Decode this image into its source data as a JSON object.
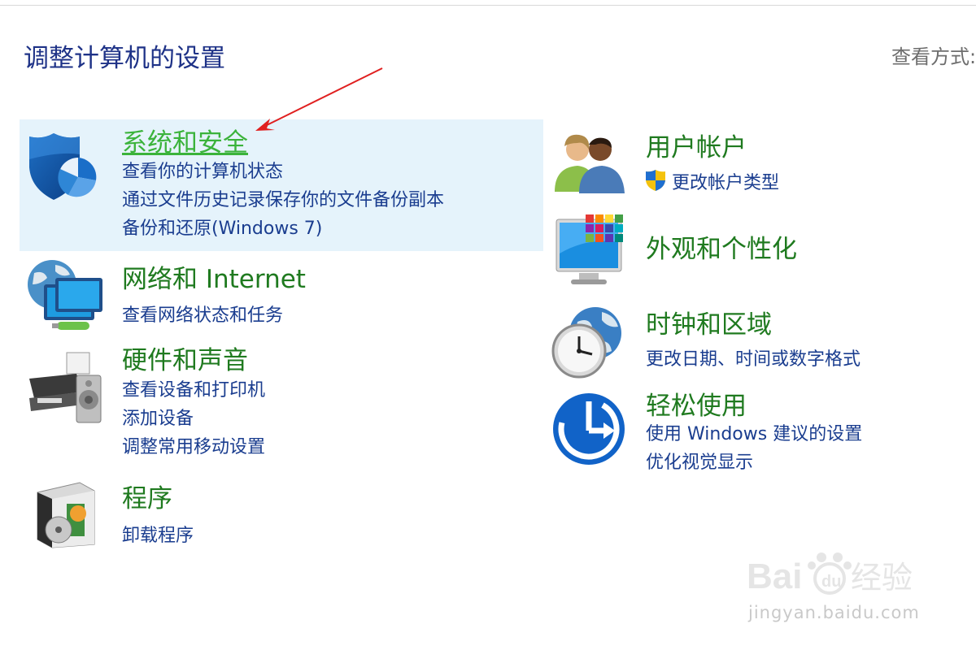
{
  "page_title": "调整计算机的设置",
  "view_by_label": "查看方式:",
  "left_categories": [
    {
      "title": "系统和安全",
      "links": [
        "查看你的计算机状态",
        "通过文件历史记录保存你的文件备份副本",
        "备份和还原(Windows 7)"
      ]
    },
    {
      "title": "网络和 Internet",
      "links": [
        "查看网络状态和任务"
      ]
    },
    {
      "title": "硬件和声音",
      "links": [
        "查看设备和打印机",
        "添加设备",
        "调整常用移动设置"
      ]
    },
    {
      "title": "程序",
      "links": [
        "卸载程序"
      ]
    }
  ],
  "right_categories": [
    {
      "title": "用户帐户",
      "links": [
        "更改帐户类型"
      ]
    },
    {
      "title": "外观和个性化",
      "links": []
    },
    {
      "title": "时钟和区域",
      "links": [
        "更改日期、时间或数字格式"
      ]
    },
    {
      "title": "轻松使用",
      "links": [
        "使用 Windows 建议的设置",
        "优化视觉显示"
      ]
    }
  ],
  "icons": {
    "system_security": "shield-icon",
    "network": "network-globe-icon",
    "hardware": "printer-speaker-icon",
    "programs": "program-box-icon",
    "user_accounts": "users-icon",
    "appearance": "monitor-color-icon",
    "clock_region": "clock-globe-icon",
    "ease_of_access": "ease-of-access-icon",
    "uac": "uac-shield-icon"
  },
  "watermark": {
    "brand": "Baidu",
    "cn": "经验",
    "url": "jingyan.baidu.com"
  },
  "colors": {
    "title_blue": "#1e3287",
    "category_green": "#1f7a1f",
    "active_green": "#3bb33b",
    "link_blue": "#1a3d8f",
    "highlight": "#e5f3fb",
    "arrow_red": "#e02020"
  }
}
